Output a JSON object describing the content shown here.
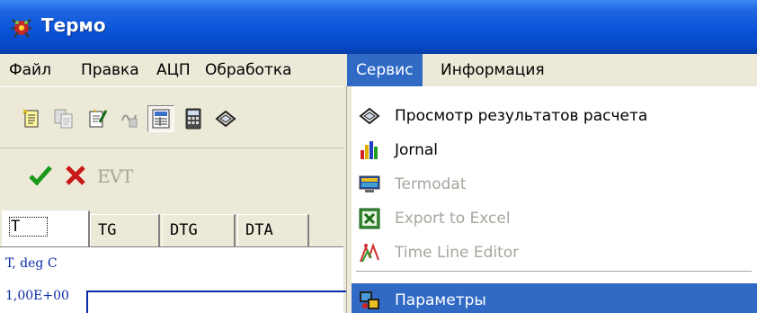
{
  "window": {
    "title": "Термо"
  },
  "menubar": {
    "items": [
      {
        "label": "Файл"
      },
      {
        "label": "Правка"
      },
      {
        "label": "АЦП"
      },
      {
        "label": "Обработка"
      },
      {
        "label": "Сервис",
        "active": true
      },
      {
        "label": "Информация"
      }
    ]
  },
  "toolbar": {
    "evt_label": "EVT"
  },
  "tabs": [
    {
      "label": "T",
      "active": true
    },
    {
      "label": "TG"
    },
    {
      "label": "DTG"
    },
    {
      "label": "DTA"
    }
  ],
  "plot": {
    "ylabel": "T, deg C",
    "ytick": "1,00E+00"
  },
  "service_menu": {
    "items": [
      {
        "label": "Просмотр результатов расчета",
        "icon": "diamond-link-icon",
        "enabled": true
      },
      {
        "label": "Jornal",
        "icon": "bar-chart-icon",
        "enabled": true
      },
      {
        "label": "Termodat",
        "icon": "monitor-icon",
        "enabled": false
      },
      {
        "label": "Export to Excel",
        "icon": "excel-icon",
        "enabled": false
      },
      {
        "label": "Time Line Editor",
        "icon": "timeline-icon",
        "enabled": false
      },
      {
        "label": "Параметры",
        "icon": "parameters-icon",
        "enabled": true,
        "highlighted": true
      }
    ]
  },
  "colors": {
    "titlebar": "#0a54d8",
    "highlight": "#316ac5",
    "axis": "#0a2aa8"
  }
}
